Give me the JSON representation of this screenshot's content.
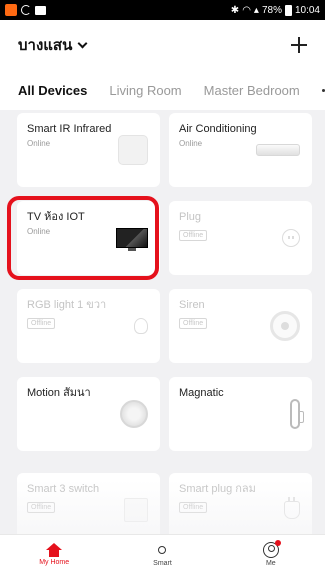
{
  "status_bar": {
    "battery": "78%",
    "time": "10:04"
  },
  "header": {
    "home_name": "บางแสน"
  },
  "tabs": [
    {
      "label": "All Devices",
      "active": true
    },
    {
      "label": "Living Room",
      "active": false
    },
    {
      "label": "Master Bedroom",
      "active": false
    }
  ],
  "devices": [
    {
      "name": "Smart IR Infrared",
      "status": "Online",
      "icon": "ir-remote-icon"
    },
    {
      "name": "Air Conditioning",
      "status": "Online",
      "icon": "air-conditioner-icon"
    },
    {
      "name": "TV ห้อง IOT",
      "status": "Online",
      "icon": "tv-icon"
    },
    {
      "name": "Plug",
      "status": "Offline",
      "icon": "plug-icon"
    },
    {
      "name": "RGB light 1 ขวา",
      "status": "Offline",
      "icon": "bulb-icon"
    },
    {
      "name": "Siren",
      "status": "Offline",
      "icon": "siren-icon"
    },
    {
      "name": "Motion สัมนา",
      "status": "",
      "icon": "motion-sensor-icon"
    },
    {
      "name": "Magnatic",
      "status": "",
      "icon": "door-sensor-icon"
    },
    {
      "name": "Smart 3 switch",
      "status": "Offline",
      "icon": "switch-icon"
    },
    {
      "name": "Smart plug กลม",
      "status": "Offline",
      "icon": "round-plug-icon"
    }
  ],
  "nav": [
    {
      "label": "My Home",
      "active": true
    },
    {
      "label": "Smart",
      "active": false
    },
    {
      "label": "Me",
      "active": false
    }
  ],
  "colors": {
    "accent": "#e5111c",
    "background": "#f1f1f3",
    "card": "#ffffff"
  }
}
